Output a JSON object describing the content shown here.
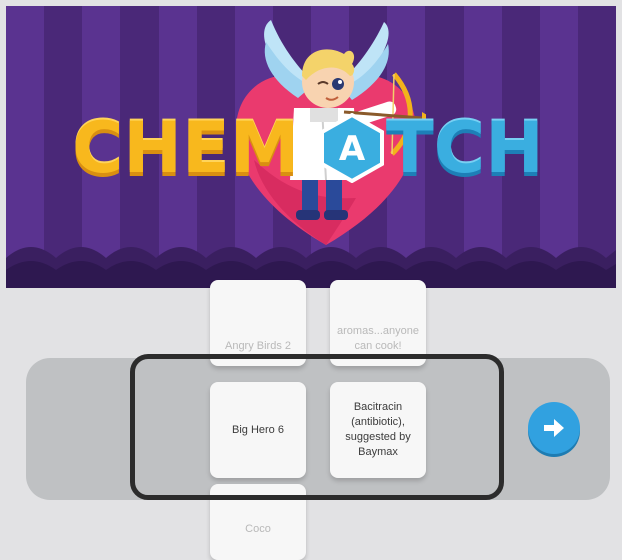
{
  "banner": {
    "logo_part1": [
      "C",
      "H",
      "E",
      "M"
    ],
    "logo_part2": [
      "A",
      "T",
      "C",
      "H"
    ],
    "logo_full": "CHEMATCH",
    "colors": {
      "curtain_dark": "#4a2878",
      "curtain_light": "#5a3390",
      "yellow": "#f8b81d",
      "blue": "#3aaee0",
      "heart": "#ea3a6e"
    },
    "mascot_icon": "cupid-scientist-with-bow"
  },
  "game": {
    "left_column": {
      "top": "Angry Birds 2",
      "selected": "Big Hero 6",
      "bottom": "Coco"
    },
    "right_column": {
      "top": "aromas...anyone can cook!",
      "selected": "Bacitracin (antibiotic), suggested by Baymax"
    },
    "next_icon": "arrow-right-icon",
    "colors": {
      "accent": "#31a1e0",
      "track": "#bfc1c3",
      "frame": "#2c2c2c"
    }
  }
}
